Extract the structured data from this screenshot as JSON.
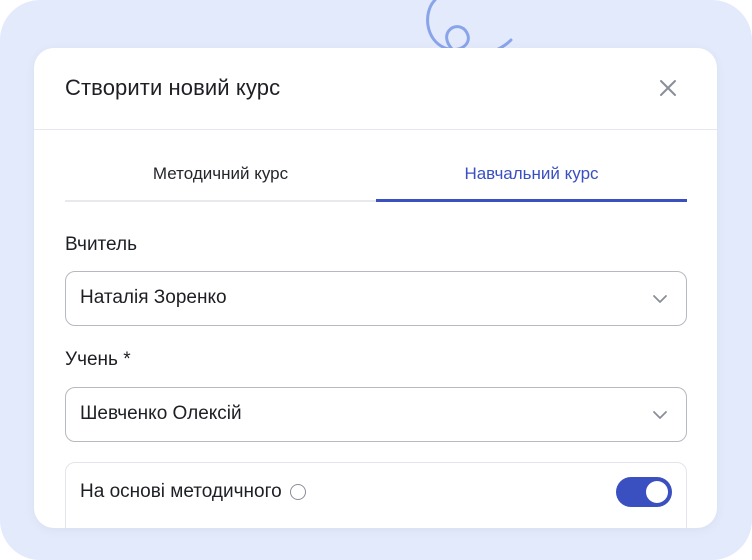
{
  "modal": {
    "title": "Створити новий курс",
    "close_icon": "close-icon"
  },
  "tabs": [
    {
      "label": "Методичний курс",
      "active": false
    },
    {
      "label": "Навчальний курс",
      "active": true
    }
  ],
  "teacher": {
    "label": "Вчитель",
    "value": "Наталія Зоренко",
    "icon": "chevron-down-icon"
  },
  "student": {
    "label": "Учень *",
    "value": "Шевченко Олексій",
    "icon": "chevron-down-icon"
  },
  "methodical_toggle": {
    "label": "На основі методичного",
    "enabled": true,
    "help_icon": "help-icon"
  },
  "colors": {
    "accent": "#3a4fc0",
    "backdrop": "#e3eafb",
    "text": "#1d1f24",
    "border": "#b6b9c0"
  }
}
